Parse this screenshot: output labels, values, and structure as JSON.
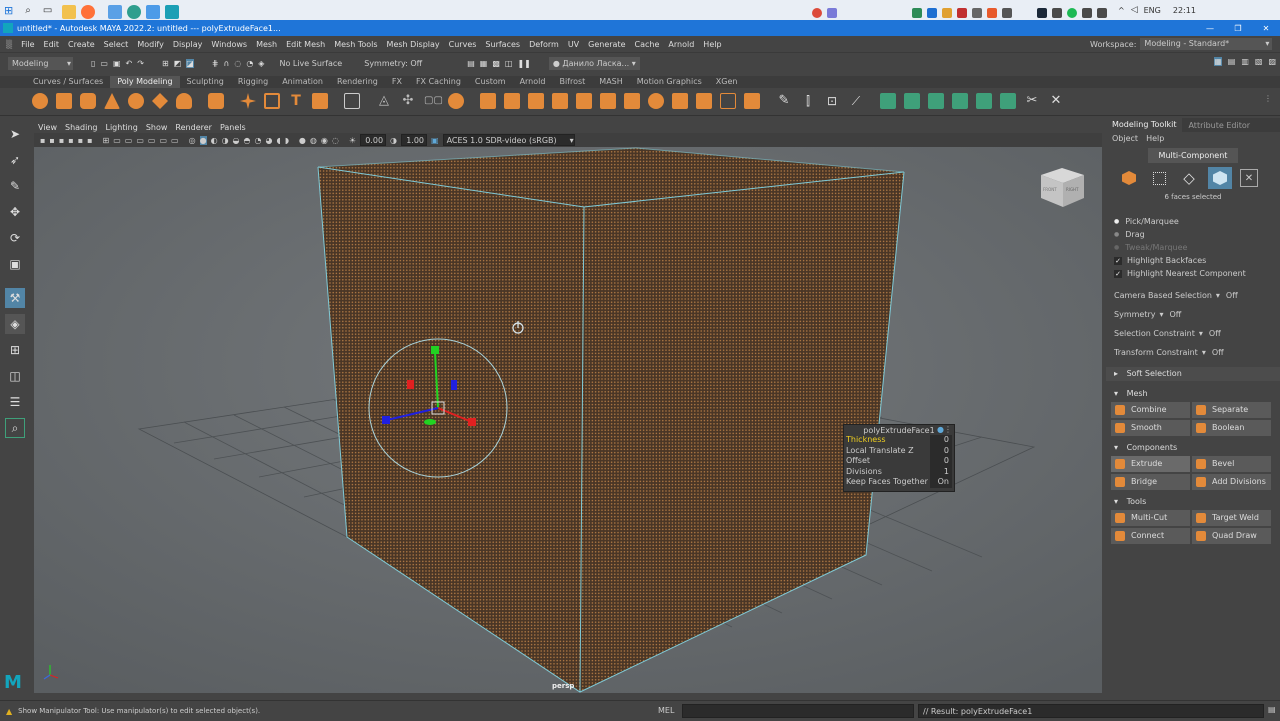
{
  "taskbar": {
    "lang": "ENG",
    "time": "22:11",
    "icons": [
      "windows-start-icon",
      "search-icon",
      "task-view-icon",
      "explorer-icon",
      "firefox-icon",
      "mail-icon",
      "edge-icon",
      "photos-icon",
      "maya-icon"
    ]
  },
  "window": {
    "title": "untitled* - Autodesk MAYA 2022.2: untitled   ---   polyExtrudeFace1..."
  },
  "menus": [
    "File",
    "Edit",
    "Create",
    "Select",
    "Modify",
    "Display",
    "Windows",
    "Mesh",
    "Edit Mesh",
    "Mesh Tools",
    "Mesh Display",
    "Curves",
    "Surfaces",
    "Deform",
    "UV",
    "Generate",
    "Cache",
    "Arnold",
    "Help"
  ],
  "workspace": {
    "label": "Workspace:",
    "value": "Modeling - Standard*"
  },
  "statusline": {
    "mode": "Modeling",
    "live_surface": "No Live Surface",
    "symmetry": "Symmetry: Off",
    "user": "Данило Ласка..."
  },
  "shelf_tabs": [
    "Curves / Surfaces",
    "Poly Modeling",
    "Sculpting",
    "Rigging",
    "Animation",
    "Rendering",
    "FX",
    "FX Caching",
    "Custom",
    "Arnold",
    "Bifrost",
    "MASH",
    "Motion Graphics",
    "XGen"
  ],
  "shelf_active": "Poly Modeling",
  "viewport": {
    "menus": [
      "View",
      "Shading",
      "Lighting",
      "Show",
      "Renderer",
      "Panels"
    ],
    "exposure": "0.00",
    "gamma": "1.00",
    "colorspace": "ACES 1.0 SDR-video (sRGB)",
    "camera": "persp",
    "viewcube": {
      "front": "FRONT",
      "right": "RIGHT"
    }
  },
  "attr_popup": {
    "title": "polyExtrudeFace1",
    "rows": [
      {
        "label": "Thickness",
        "value": "0",
        "highlight": true
      },
      {
        "label": "Local Translate Z",
        "value": "0"
      },
      {
        "label": "Offset",
        "value": "0"
      },
      {
        "label": "Divisions",
        "value": "1"
      },
      {
        "label": "Keep Faces Together",
        "value": "On"
      }
    ]
  },
  "toolkit": {
    "tabs": [
      "Modeling Toolkit",
      "Attribute Editor"
    ],
    "submenu": [
      "Object",
      "Help"
    ],
    "mode": "Multi-Component",
    "selection_info": "6 faces selected",
    "options": [
      {
        "label": "Pick/Marquee",
        "type": "radio",
        "checked": true
      },
      {
        "label": "Drag",
        "type": "radio",
        "checked": false
      },
      {
        "label": "Tweak/Marquee",
        "type": "radio",
        "checked": false,
        "disabled": true
      },
      {
        "label": "Highlight Backfaces",
        "type": "check",
        "checked": true
      },
      {
        "label": "Highlight Nearest Component",
        "type": "check",
        "checked": true
      }
    ],
    "dropdowns": [
      {
        "label": "Camera Based Selection",
        "value": "Off"
      },
      {
        "label": "Symmetry",
        "value": "Off"
      },
      {
        "label": "Selection Constraint",
        "value": "Off"
      },
      {
        "label": "Transform Constraint",
        "value": "Off"
      }
    ],
    "soft_selection": "Soft Selection",
    "sections": [
      {
        "name": "Mesh",
        "buttons": [
          "Combine",
          "Separate",
          "Smooth",
          "Boolean"
        ]
      },
      {
        "name": "Components",
        "buttons": [
          "Extrude",
          "Bevel",
          "Bridge",
          "Add Divisions"
        ]
      },
      {
        "name": "Tools",
        "buttons": [
          "Multi-Cut",
          "Target Weld",
          "Connect",
          "Quad Draw"
        ]
      }
    ]
  },
  "bottom": {
    "help": "Show Manipulator Tool: Use manipulator(s) to edit selected object(s).",
    "mel": "MEL",
    "result": "// Result: polyExtrudeFace1"
  },
  "colors": {
    "accent": "#5285a6",
    "title_blue": "#1f75d8",
    "mesh_orange": "#e38a3a",
    "cube_fill": "#4a3626",
    "wire": "#7fc9d6"
  }
}
